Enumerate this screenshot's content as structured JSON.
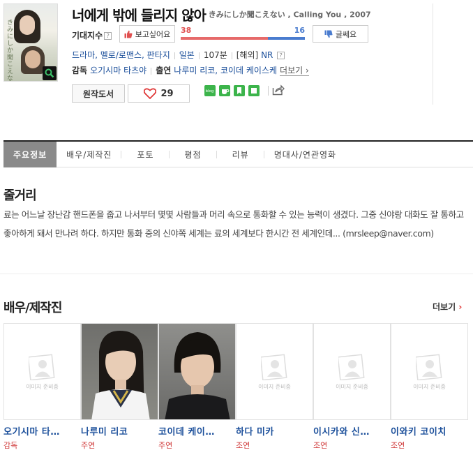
{
  "movie": {
    "title": "너에게 밖에 들리지 않아",
    "original_title": "きみにしか聞こえない , Calling You , 2007",
    "poster_vertical_text": "きみにしか聞こえない"
  },
  "expect": {
    "label": "기대지수",
    "help_icon": "?",
    "want_label": "보고싶어요",
    "no_label": "글쎄요",
    "want_count": "38",
    "no_count": "16",
    "want_ratio": 0.7
  },
  "meta": {
    "genres": "드라마, 멜로/로맨스, 판타지",
    "country": "일본",
    "runtime": "107분",
    "release_tag": "[해외]",
    "rating": "NR",
    "help_icon": "?"
  },
  "people": {
    "director_label": "감독",
    "director": "오기시마 타츠야",
    "cast_label": "출연",
    "cast": "나루미 리코, 코이데 케이스케",
    "more_label": "더보기"
  },
  "actions": {
    "book_label": "원작도서",
    "like_count": "29"
  },
  "tabs": [
    "주요정보",
    "배우/제작진",
    "포토",
    "평점",
    "리뷰",
    "명대사/연관영화"
  ],
  "synopsis": {
    "title": "줄거리",
    "text": "료는 어느날 장난감 핸드폰을 줍고 나서부터 몇몇 사람들과 머리 속으로 통화할 수 있는 능력이 생겼다. 그중 신야랑 대화도 잘 통하고 좋아하게 돼서 만나려 하다. 하지만 통화 중의 신야쪽 세계는 료의 세계보다 한시간 전 세계인데... (mrsleep@naver.com)"
  },
  "cast_section": {
    "title": "배우/제작진",
    "more_label": "더보기",
    "placeholder_text": "이미지 준비중",
    "members": [
      {
        "name": "오기시마 타…",
        "role": "감독",
        "photo": false
      },
      {
        "name": "나루미 리코",
        "role": "주연",
        "photo": true
      },
      {
        "name": "코이데 케이…",
        "role": "주연",
        "photo": true
      },
      {
        "name": "하다 미카",
        "role": "조연",
        "photo": false
      },
      {
        "name": "이시카와 신…",
        "role": "조연",
        "photo": false
      },
      {
        "name": "이와키 코이치",
        "role": "조연",
        "photo": false
      }
    ]
  },
  "colors": {
    "link": "#1a4e9a",
    "want": "#e05050",
    "no": "#4a7ccf",
    "role": "#d03c3c"
  }
}
